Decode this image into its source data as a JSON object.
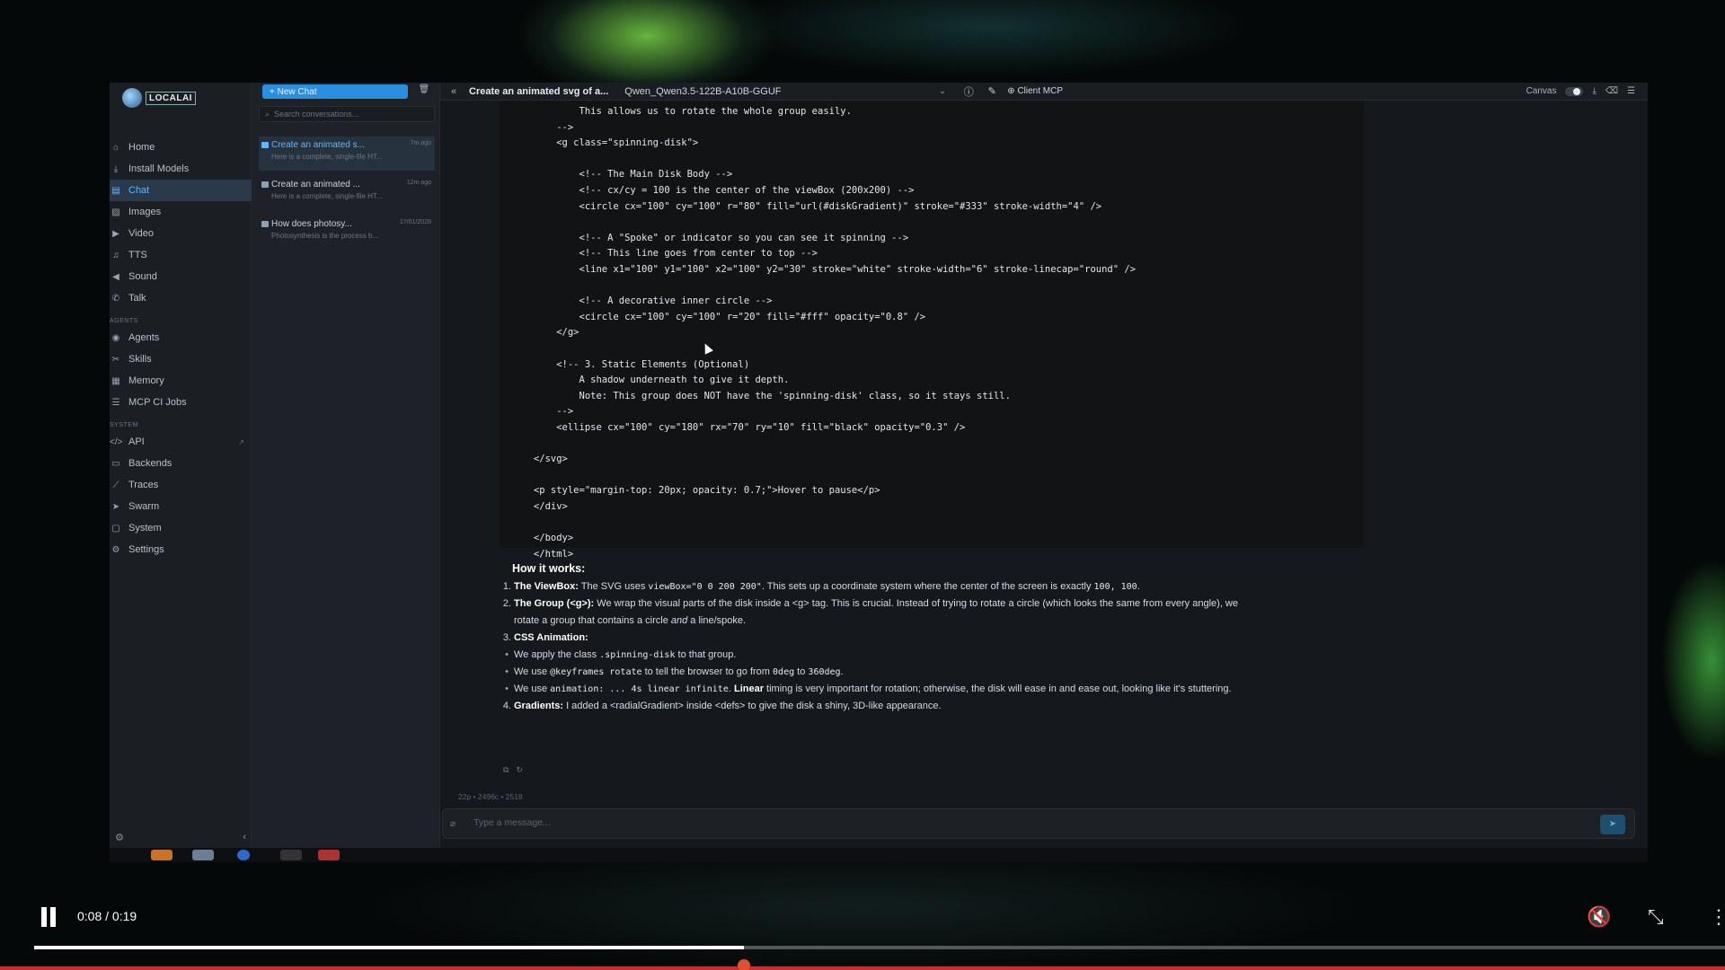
{
  "app": {
    "logo_text": "LOCALAI",
    "colors": {
      "accent": "#2b8fe0",
      "active": "#5fb8ff",
      "background": "#15181c"
    }
  },
  "sidebar": {
    "items": [
      {
        "label": "Home",
        "icon": "home-icon"
      },
      {
        "label": "Install Models",
        "icon": "download-icon"
      },
      {
        "label": "Chat",
        "icon": "chat-icon",
        "active": true
      },
      {
        "label": "Images",
        "icon": "image-icon"
      },
      {
        "label": "Video",
        "icon": "video-icon"
      },
      {
        "label": "TTS",
        "icon": "music-icon"
      },
      {
        "label": "Sound",
        "icon": "speaker-icon"
      },
      {
        "label": "Talk",
        "icon": "phone-icon"
      }
    ],
    "agents_section": "AGENTS",
    "agent_items": [
      {
        "label": "Agents",
        "icon": "agent-icon"
      },
      {
        "label": "Skills",
        "icon": "skills-icon"
      },
      {
        "label": "Memory",
        "icon": "memory-icon"
      },
      {
        "label": "MCP CI Jobs",
        "icon": "jobs-icon"
      }
    ],
    "system_section": "SYSTEM",
    "system_items": [
      {
        "label": "API",
        "icon": "code-icon"
      },
      {
        "label": "Backends",
        "icon": "server-icon"
      },
      {
        "label": "Traces",
        "icon": "chart-icon"
      },
      {
        "label": "Swarm",
        "icon": "send-icon"
      },
      {
        "label": "System",
        "icon": "monitor-icon"
      },
      {
        "label": "Settings",
        "icon": "gear-icon"
      }
    ]
  },
  "conversations": {
    "new_chat_label": "+ New Chat",
    "search_placeholder": "Search conversations...",
    "items": [
      {
        "title": "Create an animated s...",
        "time": "7m ago",
        "snippet": "Here is a complete, single-file HT...",
        "active": true
      },
      {
        "title": "Create an animated ...",
        "time": "12m ago",
        "snippet": "Here is a complete, single-file HT..."
      },
      {
        "title": "How does photosy...",
        "time": "17/01/2026",
        "snippet": "Photosynthesis is the process b..."
      }
    ]
  },
  "header": {
    "title": "Create an animated svg of a...",
    "model": "Qwen_Qwen3.5-122B-A10B-GGUF",
    "client_mcp": "Client MCP",
    "canvas_label": "Canvas"
  },
  "code_lines": [
    "        This allows us to rotate the whole group easily.",
    "    -->",
    "    <g class=\"spinning-disk\">",
    "",
    "        <!-- The Main Disk Body -->",
    "        <!-- cx/cy = 100 is the center of the viewBox (200x200) -->",
    "        <circle cx=\"100\" cy=\"100\" r=\"80\" fill=\"url(#diskGradient)\" stroke=\"#333\" stroke-width=\"4\" />",
    "",
    "        <!-- A \"Spoke\" or indicator so you can see it spinning -->",
    "        <!-- This line goes from center to top -->",
    "        <line x1=\"100\" y1=\"100\" x2=\"100\" y2=\"30\" stroke=\"white\" stroke-width=\"6\" stroke-linecap=\"round\" />",
    "",
    "        <!-- A decorative inner circle -->",
    "        <circle cx=\"100\" cy=\"100\" r=\"20\" fill=\"#fff\" opacity=\"0.8\" />",
    "    </g>",
    "",
    "    <!-- 3. Static Elements (Optional)",
    "        A shadow underneath to give it depth.",
    "        Note: This group does NOT have the 'spinning-disk' class, so it stays still.",
    "    -->",
    "    <ellipse cx=\"100\" cy=\"180\" rx=\"70\" ry=\"10\" fill=\"black\" opacity=\"0.3\" />",
    "",
    "</svg>",
    "",
    "<p style=\"margin-top: 20px; opacity: 0.7;\">Hover to pause</p>",
    "</div>",
    "",
    "</body>",
    "</html>"
  ],
  "explanation": {
    "heading": "How it works:",
    "p1_label": "The ViewBox:",
    "p1_a": " The SVG uses ",
    "p1_code1": "viewBox=\"0 0 200 200\"",
    "p1_b": ". This sets up a coordinate system where the center of the screen is exactly ",
    "p1_code2": "100, 100",
    "p1_c": ".",
    "p2_label": "The Group (<g>):",
    "p2_a": " We wrap the visual parts of the disk inside a <g> tag. This is crucial. Instead of trying to rotate a circle (which looks the same from every angle), we",
    "p2_b": "rotate a group that contains a circle ",
    "p2_em": "and",
    "p2_c": " a line/spoke.",
    "p3_label": "CSS Animation:",
    "b1_a": "We apply the class ",
    "b1_code": ".spinning-disk",
    "b1_b": " to that group.",
    "b2_a": "We use ",
    "b2_code1": "@keyframes rotate",
    "b2_b": " to tell the browser to go from ",
    "b2_code2": "0deg",
    "b2_c": " to ",
    "b2_code3": "360deg",
    "b2_d": ".",
    "b3_a": "We use ",
    "b3_code": "animation: ... 4s linear infinite",
    "b3_b": ". ",
    "b3_bold": "Linear",
    "b3_c": " timing is very important for rotation; otherwise, the disk will ease in and ease out, looking like it's stuttering.",
    "p4_label": "Gradients:",
    "p4_a": " I added a <radialGradient> inside <defs> to give the disk a shiny, 3D-like appearance."
  },
  "message_stats": "22p • 2496c • 2518",
  "composer": {
    "placeholder": "Type a message..."
  },
  "player": {
    "time": "0:08 / 0:19",
    "progress": 0.42
  }
}
